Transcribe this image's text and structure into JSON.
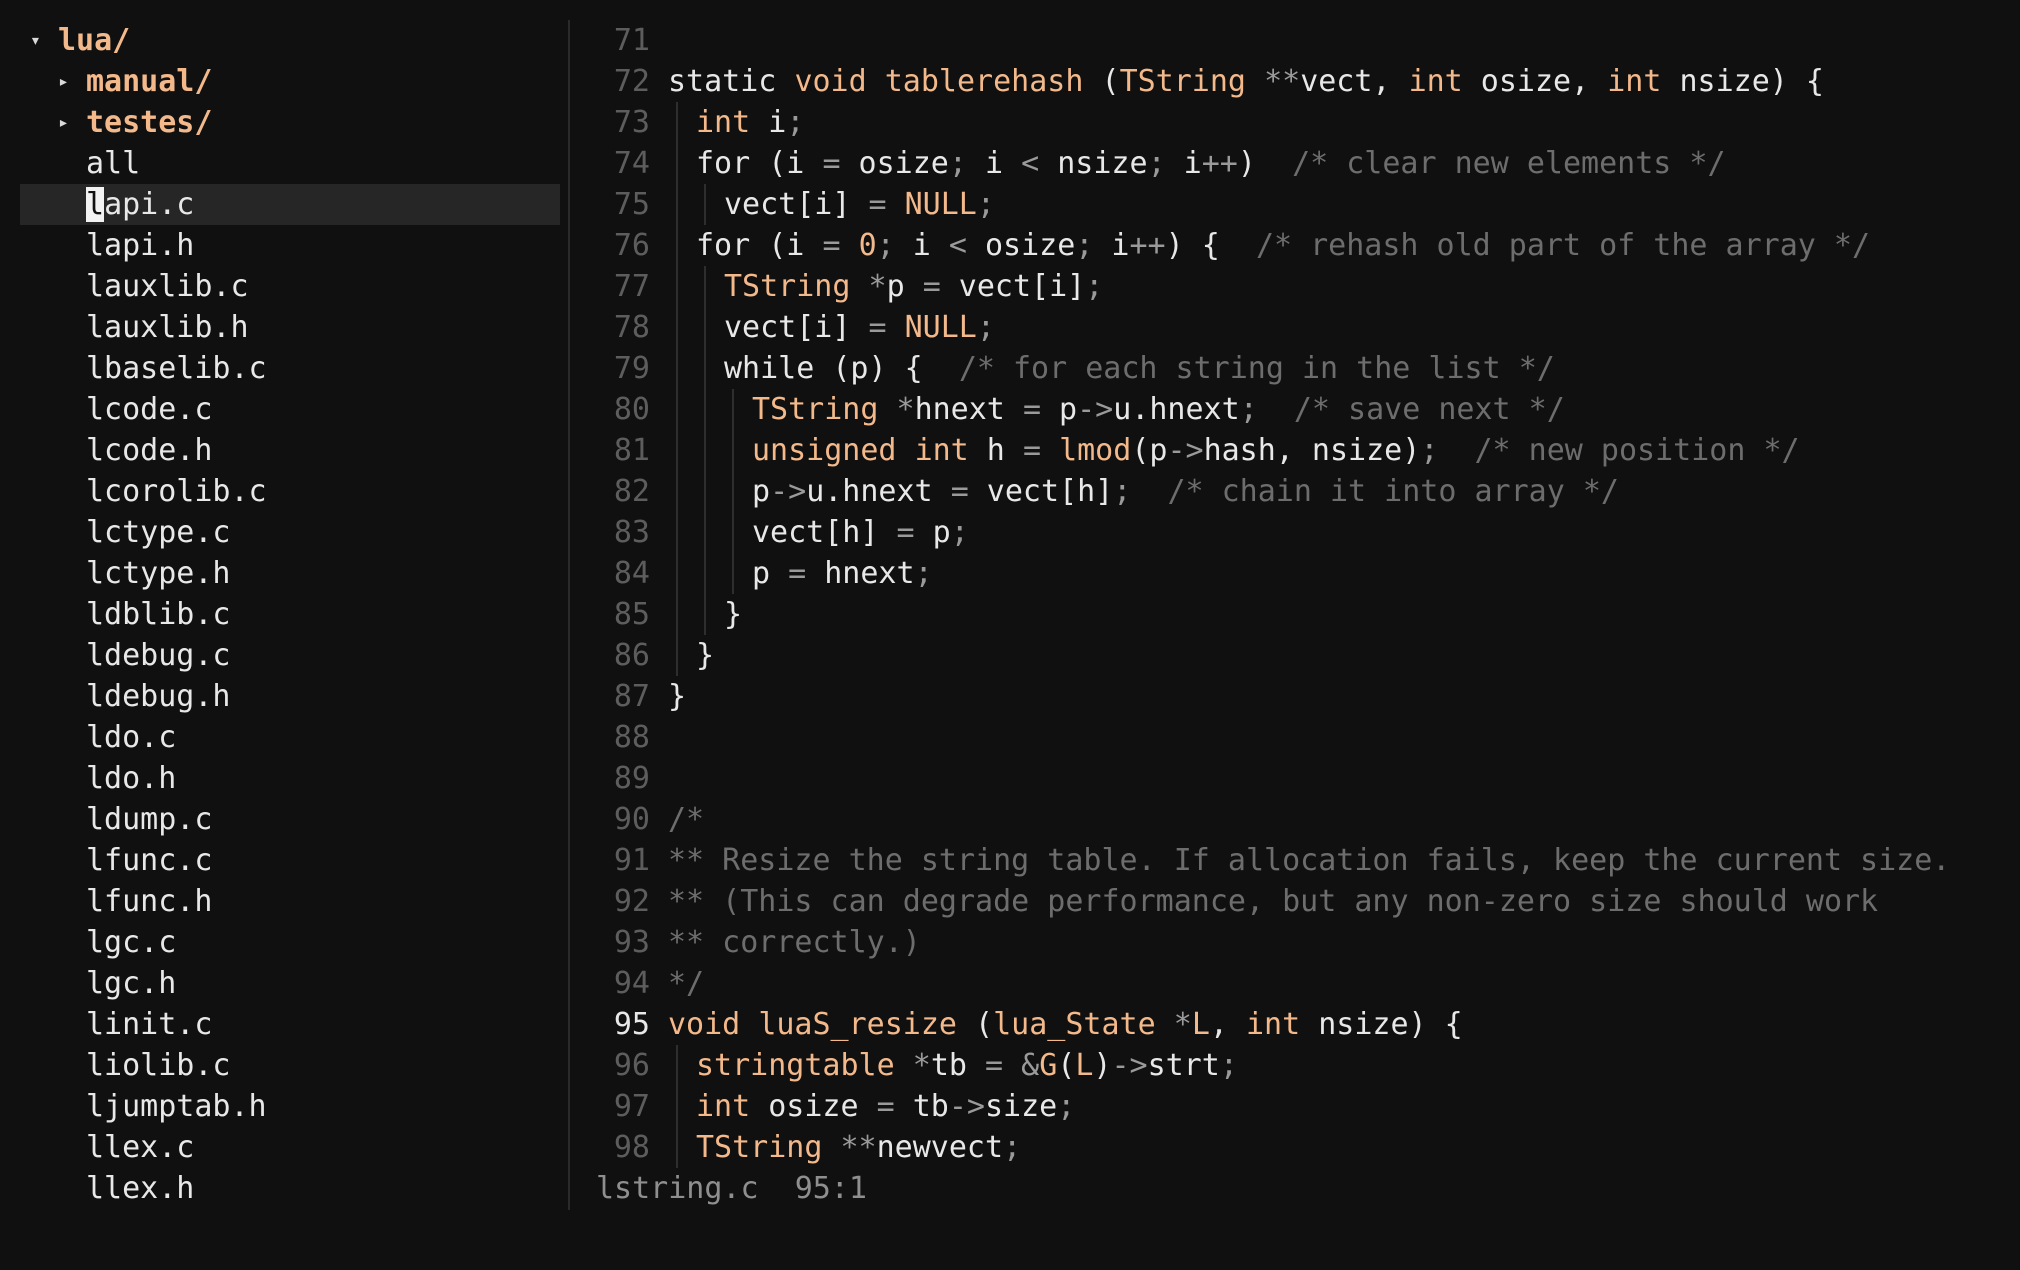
{
  "tree": {
    "items": [
      {
        "depth": 0,
        "type": "dir",
        "expanded": true,
        "name": "lua/"
      },
      {
        "depth": 1,
        "type": "dir",
        "expanded": false,
        "name": "manual/"
      },
      {
        "depth": 1,
        "type": "dir",
        "expanded": false,
        "name": "testes/"
      },
      {
        "depth": 1,
        "type": "file",
        "name": "all"
      },
      {
        "depth": 1,
        "type": "file",
        "name": "lapi.c",
        "selected": true
      },
      {
        "depth": 1,
        "type": "file",
        "name": "lapi.h"
      },
      {
        "depth": 1,
        "type": "file",
        "name": "lauxlib.c"
      },
      {
        "depth": 1,
        "type": "file",
        "name": "lauxlib.h"
      },
      {
        "depth": 1,
        "type": "file",
        "name": "lbaselib.c"
      },
      {
        "depth": 1,
        "type": "file",
        "name": "lcode.c"
      },
      {
        "depth": 1,
        "type": "file",
        "name": "lcode.h"
      },
      {
        "depth": 1,
        "type": "file",
        "name": "lcorolib.c"
      },
      {
        "depth": 1,
        "type": "file",
        "name": "lctype.c"
      },
      {
        "depth": 1,
        "type": "file",
        "name": "lctype.h"
      },
      {
        "depth": 1,
        "type": "file",
        "name": "ldblib.c"
      },
      {
        "depth": 1,
        "type": "file",
        "name": "ldebug.c"
      },
      {
        "depth": 1,
        "type": "file",
        "name": "ldebug.h"
      },
      {
        "depth": 1,
        "type": "file",
        "name": "ldo.c"
      },
      {
        "depth": 1,
        "type": "file",
        "name": "ldo.h"
      },
      {
        "depth": 1,
        "type": "file",
        "name": "ldump.c"
      },
      {
        "depth": 1,
        "type": "file",
        "name": "lfunc.c"
      },
      {
        "depth": 1,
        "type": "file",
        "name": "lfunc.h"
      },
      {
        "depth": 1,
        "type": "file",
        "name": "lgc.c"
      },
      {
        "depth": 1,
        "type": "file",
        "name": "lgc.h"
      },
      {
        "depth": 1,
        "type": "file",
        "name": "linit.c"
      },
      {
        "depth": 1,
        "type": "file",
        "name": "liolib.c"
      },
      {
        "depth": 1,
        "type": "file",
        "name": "ljumptab.h"
      },
      {
        "depth": 1,
        "type": "file",
        "name": "llex.c"
      },
      {
        "depth": 1,
        "type": "file",
        "name": "llex.h"
      }
    ]
  },
  "editor": {
    "current_line": 95,
    "lines": [
      {
        "n": "71",
        "indent": 0,
        "tokens": []
      },
      {
        "n": "72",
        "indent": 0,
        "tokens": [
          [
            "static",
            "p"
          ],
          [
            " ",
            "p"
          ],
          [
            "void",
            "kw"
          ],
          [
            " ",
            "p"
          ],
          [
            "tablerehash",
            "ty"
          ],
          [
            " (",
            "p"
          ],
          [
            "TString",
            "ty"
          ],
          [
            " ",
            "p"
          ],
          [
            "**",
            "op"
          ],
          [
            "vect, ",
            "p"
          ],
          [
            "int",
            "kw"
          ],
          [
            " osize, ",
            "p"
          ],
          [
            "int",
            "kw"
          ],
          [
            " nsize) {",
            "p"
          ]
        ]
      },
      {
        "n": "73",
        "indent": 1,
        "tokens": [
          [
            "int",
            "kw"
          ],
          [
            " i",
            "p"
          ],
          [
            ";",
            "op"
          ]
        ]
      },
      {
        "n": "74",
        "indent": 1,
        "tokens": [
          [
            "for",
            "p"
          ],
          [
            " (i ",
            "p"
          ],
          [
            "=",
            "op"
          ],
          [
            " osize",
            "p"
          ],
          [
            ";",
            "op"
          ],
          [
            " i ",
            "p"
          ],
          [
            "<",
            "op"
          ],
          [
            " nsize",
            "p"
          ],
          [
            ";",
            "op"
          ],
          [
            " i",
            "p"
          ],
          [
            "++",
            "op"
          ],
          [
            ")  ",
            "p"
          ],
          [
            "/* clear new elements */",
            "cm"
          ]
        ]
      },
      {
        "n": "75",
        "indent": 2,
        "tokens": [
          [
            "vect[i] ",
            "p"
          ],
          [
            "=",
            "op"
          ],
          [
            " ",
            "p"
          ],
          [
            "NULL",
            "num"
          ],
          [
            ";",
            "op"
          ]
        ]
      },
      {
        "n": "76",
        "indent": 1,
        "tokens": [
          [
            "for",
            "p"
          ],
          [
            " (i ",
            "p"
          ],
          [
            "=",
            "op"
          ],
          [
            " ",
            "p"
          ],
          [
            "0",
            "num"
          ],
          [
            ";",
            "op"
          ],
          [
            " i ",
            "p"
          ],
          [
            "<",
            "op"
          ],
          [
            " osize",
            "p"
          ],
          [
            ";",
            "op"
          ],
          [
            " i",
            "p"
          ],
          [
            "++",
            "op"
          ],
          [
            ") {  ",
            "p"
          ],
          [
            "/* rehash old part of the array */",
            "cm"
          ]
        ]
      },
      {
        "n": "77",
        "indent": 2,
        "tokens": [
          [
            "TString",
            "ty"
          ],
          [
            " ",
            "p"
          ],
          [
            "*",
            "op"
          ],
          [
            "p ",
            "p"
          ],
          [
            "=",
            "op"
          ],
          [
            " vect[i]",
            "p"
          ],
          [
            ";",
            "op"
          ]
        ]
      },
      {
        "n": "78",
        "indent": 2,
        "tokens": [
          [
            "vect[i] ",
            "p"
          ],
          [
            "=",
            "op"
          ],
          [
            " ",
            "p"
          ],
          [
            "NULL",
            "num"
          ],
          [
            ";",
            "op"
          ]
        ]
      },
      {
        "n": "79",
        "indent": 2,
        "tokens": [
          [
            "while",
            "p"
          ],
          [
            " (p) {  ",
            "p"
          ],
          [
            "/* for each string in the list */",
            "cm"
          ]
        ]
      },
      {
        "n": "80",
        "indent": 3,
        "tokens": [
          [
            "TString",
            "ty"
          ],
          [
            " ",
            "p"
          ],
          [
            "*",
            "op"
          ],
          [
            "hnext ",
            "p"
          ],
          [
            "=",
            "op"
          ],
          [
            " p",
            "p"
          ],
          [
            "->",
            "op"
          ],
          [
            "u.hnext",
            "p"
          ],
          [
            ";",
            "op"
          ],
          [
            "  ",
            "p"
          ],
          [
            "/* save next */",
            "cm"
          ]
        ]
      },
      {
        "n": "81",
        "indent": 3,
        "tokens": [
          [
            "unsigned",
            "kw"
          ],
          [
            " ",
            "p"
          ],
          [
            "int",
            "kw"
          ],
          [
            " h ",
            "p"
          ],
          [
            "=",
            "op"
          ],
          [
            " ",
            "p"
          ],
          [
            "lmod",
            "ty"
          ],
          [
            "(p",
            "p"
          ],
          [
            "->",
            "op"
          ],
          [
            "hash, nsize)",
            "p"
          ],
          [
            ";",
            "op"
          ],
          [
            "  ",
            "p"
          ],
          [
            "/* new position */",
            "cm"
          ]
        ]
      },
      {
        "n": "82",
        "indent": 3,
        "tokens": [
          [
            "p",
            "p"
          ],
          [
            "->",
            "op"
          ],
          [
            "u.hnext ",
            "p"
          ],
          [
            "=",
            "op"
          ],
          [
            " vect[h]",
            "p"
          ],
          [
            ";",
            "op"
          ],
          [
            "  ",
            "p"
          ],
          [
            "/* chain it into array */",
            "cm"
          ]
        ]
      },
      {
        "n": "83",
        "indent": 3,
        "tokens": [
          [
            "vect[h] ",
            "p"
          ],
          [
            "=",
            "op"
          ],
          [
            " p",
            "p"
          ],
          [
            ";",
            "op"
          ]
        ]
      },
      {
        "n": "84",
        "indent": 3,
        "tokens": [
          [
            "p ",
            "p"
          ],
          [
            "=",
            "op"
          ],
          [
            " hnext",
            "p"
          ],
          [
            ";",
            "op"
          ]
        ]
      },
      {
        "n": "85",
        "indent": 2,
        "tokens": [
          [
            "}",
            "p"
          ]
        ]
      },
      {
        "n": "86",
        "indent": 1,
        "tokens": [
          [
            "}",
            "p"
          ]
        ]
      },
      {
        "n": "87",
        "indent": 0,
        "tokens": [
          [
            "}",
            "p"
          ]
        ]
      },
      {
        "n": "88",
        "indent": 0,
        "tokens": []
      },
      {
        "n": "89",
        "indent": 0,
        "tokens": []
      },
      {
        "n": "90",
        "indent": 0,
        "tokens": [
          [
            "/*",
            "cm"
          ]
        ]
      },
      {
        "n": "91",
        "indent": 0,
        "tokens": [
          [
            "** Resize the string table. If allocation fails, keep the current size.",
            "cm"
          ]
        ]
      },
      {
        "n": "92",
        "indent": 0,
        "tokens": [
          [
            "** (This can degrade performance, but any non-zero size should work",
            "cm"
          ]
        ]
      },
      {
        "n": "93",
        "indent": 0,
        "tokens": [
          [
            "** correctly.)",
            "cm"
          ]
        ]
      },
      {
        "n": "94",
        "indent": 0,
        "tokens": [
          [
            "*/",
            "cm"
          ]
        ]
      },
      {
        "n": "95",
        "indent": 0,
        "tokens": [
          [
            "void",
            "kw"
          ],
          [
            " ",
            "p"
          ],
          [
            "luaS_resize",
            "ty"
          ],
          [
            " (",
            "p"
          ],
          [
            "lua_State",
            "ty"
          ],
          [
            " ",
            "p"
          ],
          [
            "*",
            "op"
          ],
          [
            "L",
            "ty"
          ],
          [
            ", ",
            "p"
          ],
          [
            "int",
            "kw"
          ],
          [
            " nsize) {",
            "p"
          ]
        ]
      },
      {
        "n": "96",
        "indent": 1,
        "tokens": [
          [
            "stringtable",
            "ty"
          ],
          [
            " ",
            "p"
          ],
          [
            "*",
            "op"
          ],
          [
            "tb ",
            "p"
          ],
          [
            "=",
            "op"
          ],
          [
            " ",
            "p"
          ],
          [
            "&",
            "op"
          ],
          [
            "G",
            "ty"
          ],
          [
            "(",
            "p"
          ],
          [
            "L",
            "ty"
          ],
          [
            ")",
            "p"
          ],
          [
            "->",
            "op"
          ],
          [
            "strt",
            "p"
          ],
          [
            ";",
            "op"
          ]
        ]
      },
      {
        "n": "97",
        "indent": 1,
        "tokens": [
          [
            "int",
            "kw"
          ],
          [
            " osize ",
            "p"
          ],
          [
            "=",
            "op"
          ],
          [
            " tb",
            "p"
          ],
          [
            "->",
            "op"
          ],
          [
            "size",
            "p"
          ],
          [
            ";",
            "op"
          ]
        ]
      },
      {
        "n": "98",
        "indent": 1,
        "tokens": [
          [
            "TString",
            "ty"
          ],
          [
            " ",
            "p"
          ],
          [
            "**",
            "op"
          ],
          [
            "newvect",
            "p"
          ],
          [
            ";",
            "op"
          ]
        ]
      }
    ]
  },
  "status": {
    "filename": "lstring.c",
    "position": "95:1"
  }
}
